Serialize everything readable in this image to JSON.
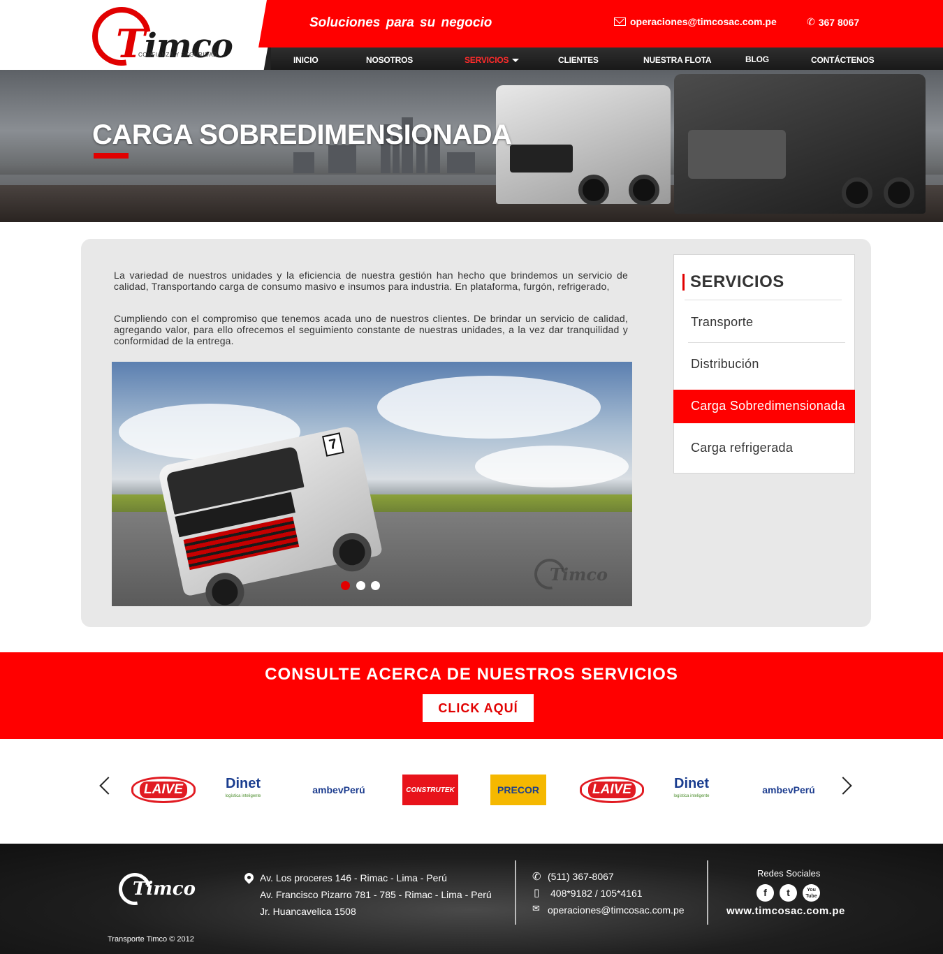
{
  "brand": {
    "name": "Timco",
    "tagline": "CONFIANZA Y SEGURIDAD",
    "accent": "#ff0000"
  },
  "topbar": {
    "slogan": "Soluciones para su negocio",
    "email": "operaciones@timcosac.com.pe",
    "phone": "367 8067",
    "email_icon": "envelope-icon",
    "phone_icon": "phone-icon"
  },
  "nav": {
    "items": [
      {
        "label": "INICIO"
      },
      {
        "label": "NOSOTROS"
      },
      {
        "label": "SERVICIOS",
        "active": true,
        "dropdown": true
      },
      {
        "label": "CLIENTES"
      },
      {
        "label": "NUESTRA FLOTA"
      },
      {
        "label": "BLOG"
      },
      {
        "label": "CONTÁCTENOS"
      }
    ]
  },
  "hero": {
    "title": "CARGA SOBREDIMENSIONADA"
  },
  "content": {
    "paragraphs": [
      "La variedad de nuestros unidades y la eficiencia de nuestra gestión han hecho que brindemos un servicio de calidad, Transportando carga de consumo masivo e insumos para industria. En plataforma, furgón, refrigerado,",
      "Cumpliendo con el compromiso que tenemos acada uno de nuestros clientes. De brindar un servicio de calidad, agregando valor, para ello ofrecemos el seguimiento constante de nuestras unidades, a la vez dar tranquilidad y conformidad de la entrega."
    ],
    "slider": {
      "slides": 3,
      "active_slide": 1,
      "watermark": "Timco"
    }
  },
  "sidebar": {
    "title": "SERVICIOS",
    "items": [
      {
        "label": "Transporte"
      },
      {
        "label": "Distribución"
      },
      {
        "label": "Carga Sobredimensionada",
        "active": true
      },
      {
        "label": "Carga refrigerada"
      }
    ]
  },
  "cta": {
    "title": "CONSULTE ACERCA DE NUESTROS SERVICIOS",
    "button": "CLICK AQUÍ"
  },
  "clients": {
    "logos": [
      "LAIVE",
      "Dinet",
      "ambevPerú",
      "CONSTRUTEK",
      "PRECOR",
      "LAIVE",
      "Dinet",
      "ambevPerú"
    ],
    "dinet_sub": "logística inteligente",
    "prev_icon": "chevron-left-icon",
    "next_icon": "chevron-right-icon"
  },
  "footer": {
    "addresses": [
      "Av. Los proceres 146 - Rimac - Lima - Perú",
      "Av. Francisco Pizarro 781 - 785 - Rimac - Lima - Perú",
      "Jr. Huancavelica 1508"
    ],
    "phone": "(511) 367-8067",
    "mobile": "408*9182 / 105*4161",
    "email": "operaciones@timcosac.com.pe",
    "social_title": "Redes Sociales",
    "social": [
      "f",
      "t",
      "You Tube"
    ],
    "website": "www.timcosac.com.pe",
    "copyright": "Transporte Timco © 2012"
  }
}
